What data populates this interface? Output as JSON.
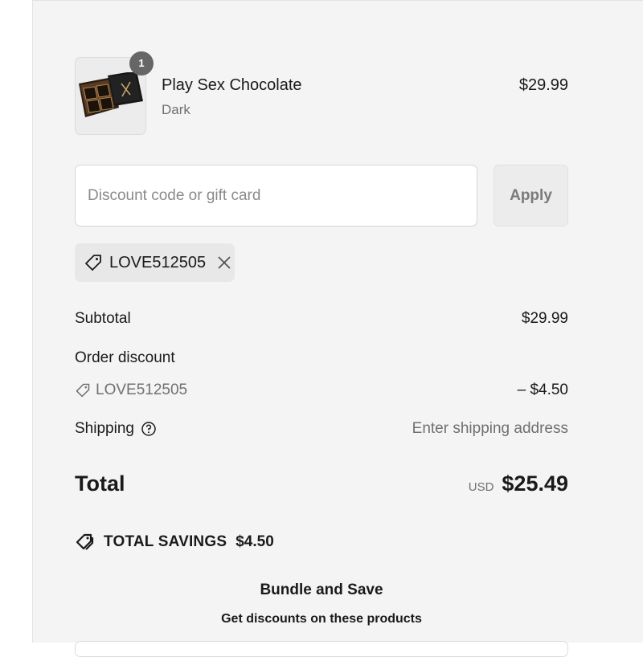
{
  "product": {
    "name": "Play Sex Chocolate",
    "variant": "Dark",
    "price": "$29.99",
    "quantity": "1",
    "image_icon": "chocolate-box-image"
  },
  "discount": {
    "placeholder": "Discount code or gift card",
    "value": "",
    "apply_label": "Apply"
  },
  "applied_code": {
    "code": "LOVE512505",
    "tag_icon": "tag-icon",
    "remove_icon": "close-icon"
  },
  "totals": {
    "subtotal_label": "Subtotal",
    "subtotal_value": "$29.99",
    "order_discount_label": "Order discount",
    "discount_code": "LOVE512505",
    "discount_value": "– $4.50",
    "shipping_label": "Shipping",
    "shipping_value": "Enter shipping address",
    "total_label": "Total",
    "currency": "USD",
    "total_value": "$25.49"
  },
  "savings": {
    "label": "TOTAL SAVINGS",
    "amount": "$4.50"
  },
  "bundle": {
    "title": "Bundle and Save",
    "subtitle": "Get discounts on these products"
  },
  "colors": {
    "panel_bg": "#f4f4f4",
    "muted_text": "#707070",
    "badge": "#666666"
  }
}
